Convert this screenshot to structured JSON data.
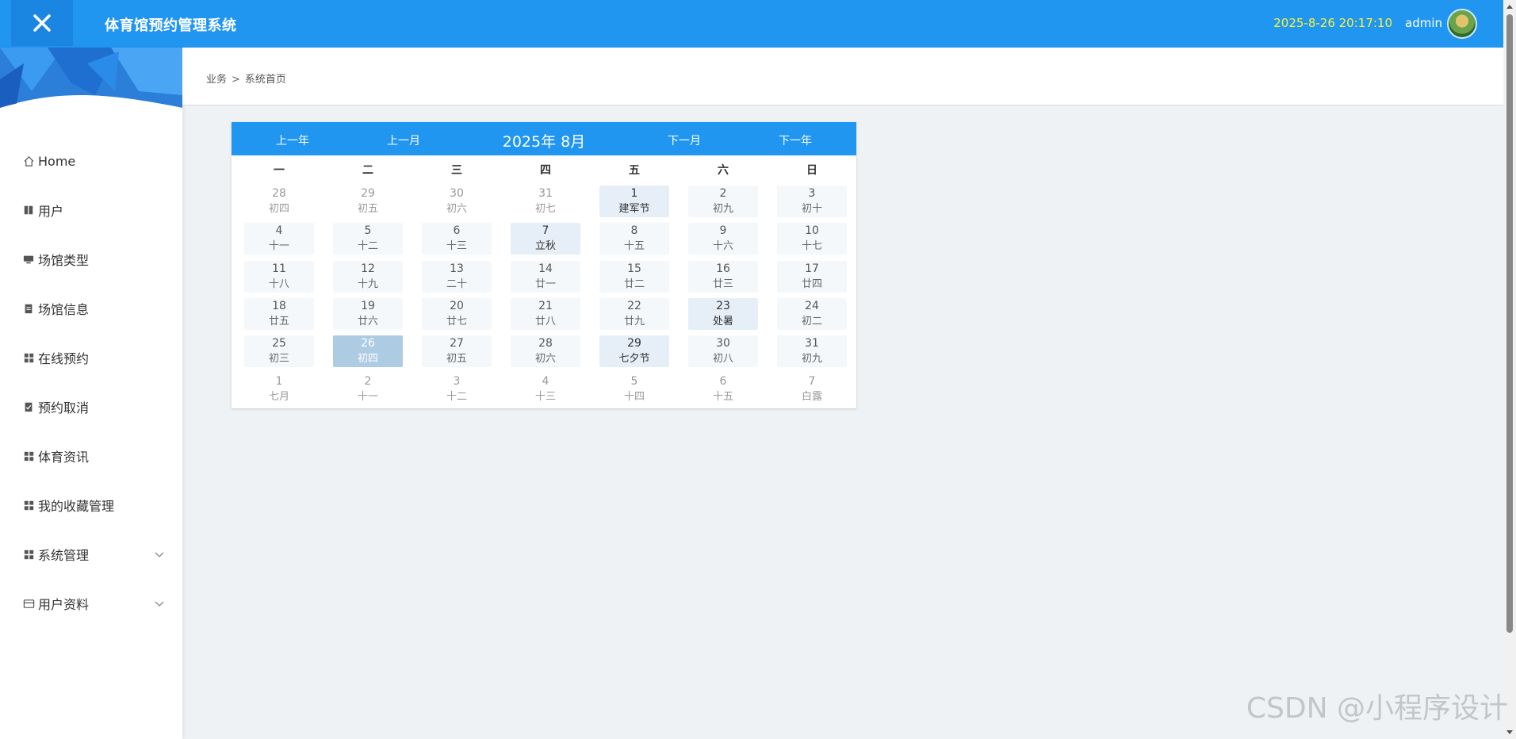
{
  "header": {
    "title": "体育馆预约管理系统",
    "datetime": "2025-8-26 20:17:10",
    "username": "admin",
    "close_icon": "close-icon"
  },
  "sidebar": {
    "items": [
      {
        "label": "Home",
        "icon": "home-icon"
      },
      {
        "label": "用户",
        "icon": "book-icon"
      },
      {
        "label": "场馆类型",
        "icon": "monitor-icon"
      },
      {
        "label": "场馆信息",
        "icon": "clipboard-icon"
      },
      {
        "label": "在线预约",
        "icon": "grid-icon"
      },
      {
        "label": "预约取消",
        "icon": "clipboard-check-icon"
      },
      {
        "label": "体育资讯",
        "icon": "grid-icon"
      },
      {
        "label": "我的收藏管理",
        "icon": "grid-icon"
      },
      {
        "label": "系统管理",
        "icon": "grid-icon",
        "expandable": true
      },
      {
        "label": "用户资料",
        "icon": "card-icon",
        "expandable": true
      }
    ]
  },
  "breadcrumb": {
    "root": "业务",
    "separator": ">",
    "current": "系统首页"
  },
  "calendar": {
    "prev_year": "上一年",
    "prev_month": "上一月",
    "current": "2025年 8月",
    "next_month": "下一月",
    "next_year": "下一年",
    "weekdays": [
      "一",
      "二",
      "三",
      "四",
      "五",
      "六",
      "日"
    ],
    "days": [
      {
        "num": "28",
        "lunar": "初四",
        "type": "other"
      },
      {
        "num": "29",
        "lunar": "初五",
        "type": "other"
      },
      {
        "num": "30",
        "lunar": "初六",
        "type": "other"
      },
      {
        "num": "31",
        "lunar": "初七",
        "type": "other"
      },
      {
        "num": "1",
        "lunar": "建军节",
        "type": "festival"
      },
      {
        "num": "2",
        "lunar": "初九",
        "type": "cur"
      },
      {
        "num": "3",
        "lunar": "初十",
        "type": "cur"
      },
      {
        "num": "4",
        "lunar": "十一",
        "type": "cur"
      },
      {
        "num": "5",
        "lunar": "十二",
        "type": "cur"
      },
      {
        "num": "6",
        "lunar": "十三",
        "type": "cur"
      },
      {
        "num": "7",
        "lunar": "立秋",
        "type": "festival"
      },
      {
        "num": "8",
        "lunar": "十五",
        "type": "cur"
      },
      {
        "num": "9",
        "lunar": "十六",
        "type": "cur"
      },
      {
        "num": "10",
        "lunar": "十七",
        "type": "cur"
      },
      {
        "num": "11",
        "lunar": "十八",
        "type": "cur"
      },
      {
        "num": "12",
        "lunar": "十九",
        "type": "cur"
      },
      {
        "num": "13",
        "lunar": "二十",
        "type": "cur"
      },
      {
        "num": "14",
        "lunar": "廿一",
        "type": "cur"
      },
      {
        "num": "15",
        "lunar": "廿二",
        "type": "cur"
      },
      {
        "num": "16",
        "lunar": "廿三",
        "type": "cur"
      },
      {
        "num": "17",
        "lunar": "廿四",
        "type": "cur"
      },
      {
        "num": "18",
        "lunar": "廿五",
        "type": "cur"
      },
      {
        "num": "19",
        "lunar": "廿六",
        "type": "cur"
      },
      {
        "num": "20",
        "lunar": "廿七",
        "type": "cur"
      },
      {
        "num": "21",
        "lunar": "廿八",
        "type": "cur"
      },
      {
        "num": "22",
        "lunar": "廿九",
        "type": "cur"
      },
      {
        "num": "23",
        "lunar": "处暑",
        "type": "festival"
      },
      {
        "num": "24",
        "lunar": "初二",
        "type": "cur"
      },
      {
        "num": "25",
        "lunar": "初三",
        "type": "cur"
      },
      {
        "num": "26",
        "lunar": "初四",
        "type": "today"
      },
      {
        "num": "27",
        "lunar": "初五",
        "type": "cur"
      },
      {
        "num": "28",
        "lunar": "初六",
        "type": "cur"
      },
      {
        "num": "29",
        "lunar": "七夕节",
        "type": "festival"
      },
      {
        "num": "30",
        "lunar": "初八",
        "type": "cur"
      },
      {
        "num": "31",
        "lunar": "初九",
        "type": "cur"
      },
      {
        "num": "1",
        "lunar": "七月",
        "type": "other"
      },
      {
        "num": "2",
        "lunar": "十一",
        "type": "other"
      },
      {
        "num": "3",
        "lunar": "十二",
        "type": "other"
      },
      {
        "num": "4",
        "lunar": "十三",
        "type": "other"
      },
      {
        "num": "5",
        "lunar": "十四",
        "type": "other"
      },
      {
        "num": "6",
        "lunar": "十五",
        "type": "other"
      },
      {
        "num": "7",
        "lunar": "白露",
        "type": "other"
      }
    ]
  },
  "watermark": "CSDN @小程序设计",
  "colors": {
    "primary": "#2196f0",
    "clock": "#f9f23c",
    "today": "#aecbe4",
    "festival": "#e6eef7",
    "background": "#eef2f5"
  }
}
